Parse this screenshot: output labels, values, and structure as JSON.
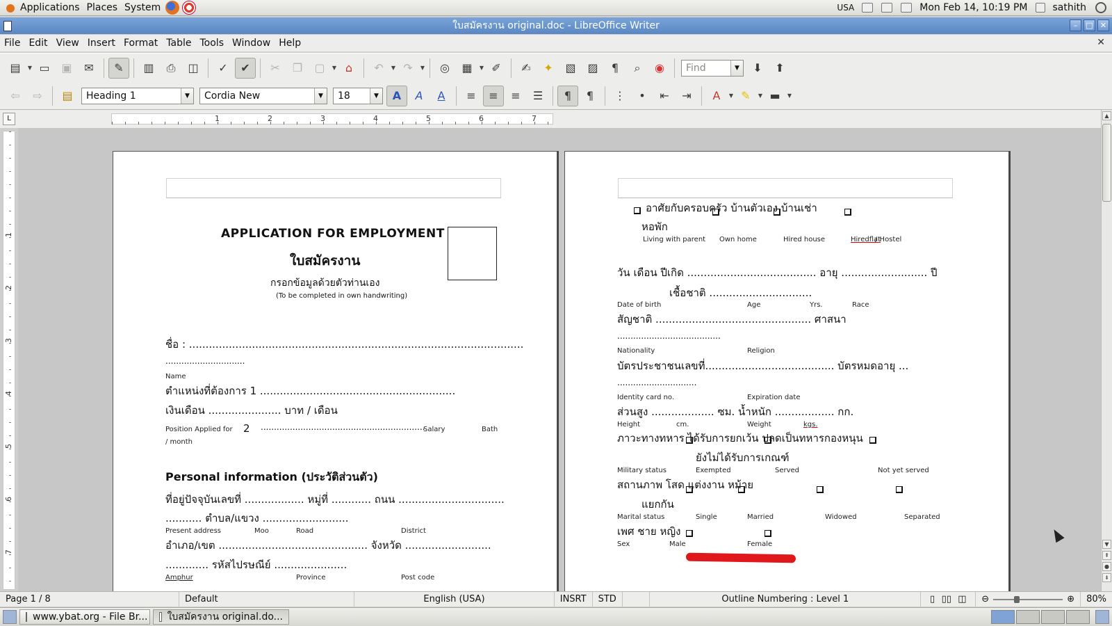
{
  "panel": {
    "applications": "Applications",
    "places": "Places",
    "system": "System",
    "locale": "USA",
    "clock": "Mon Feb 14, 10:19 PM",
    "user": "sathith"
  },
  "window": {
    "title": "ใบสมัครงาน original.doc - LibreOffice Writer",
    "minimize_label": "–",
    "maximize_label": "□",
    "close_label": "✕"
  },
  "menubar": {
    "items": [
      "File",
      "Edit",
      "View",
      "Insert",
      "Format",
      "Table",
      "Tools",
      "Window",
      "Help"
    ],
    "doc_close": "✕"
  },
  "toolbar": {
    "find_placeholder": "Find"
  },
  "formatting": {
    "paragraph_style": "Heading 1",
    "font_name": "Cordia New",
    "font_size": "18"
  },
  "ruler": {
    "labels": [
      "1",
      "2",
      "3",
      "4",
      "5",
      "6",
      "7"
    ],
    "vlabels": [
      "1",
      "2",
      "3",
      "4",
      "5",
      "6",
      "7"
    ]
  },
  "page1": {
    "title_en": "APPLICATION FOR EMPLOYMENT",
    "title_th": "ใบสมัครงาน",
    "instruction_th": "กรอกข้อมูลด้วยตัวท่านเอง",
    "instruction_en": "(To be completed in own handwriting)",
    "name_th": "ชื่อ   :  .....................................................................................................",
    "name_cont": "..............................",
    "name_en": "Name",
    "position_th": "ตำแหน่งที่ต้องการ               1         ...........................................................",
    "salary_th": "เงินเดือน   ......................   บาท / เดือน",
    "position_en": "Position Applied for",
    "position_num": "2",
    "position_dots": "..............................................................",
    "salary_en": "Salary",
    "bath_en": "Bath",
    "month_en": "/ month",
    "personal_heading": "Personal information (ประวัติส่วนตัว)",
    "address_th": "ที่อยู่ปัจจุบันเลขที่  ..................  หมู่ที่  ............   ถนน   ................................",
    "address_cont": "...........      ตำบล/แขวง    ..........................",
    "present_en": "Present address",
    "moo_en": "Moo",
    "road_en": "Road",
    "district_en": "District",
    "amphur_th": "อำเภอ/เขต   .............................................        จังหวัด    ..........................",
    "postal_th": ".............      รหัสไปรษณีย์    ......................",
    "amphur_en": "Amphur",
    "province_en": "Province",
    "postcode_en": "Post code"
  },
  "page2": {
    "living_th": "อาศัยกับครอบครัว     บ้านตัวเอง           บ้านเช่า",
    "dorm_th": "หอพัก",
    "living_en": "Living with parent",
    "own_home_en": "Own home",
    "hired_house_en": "Hired house",
    "hiredflat_en": "Hiredflat",
    "hostel_en": "/ Hostel",
    "dob_th": "วัน เดือน ปีเกิด  .......................................   อายุ  ..........................   ปี",
    "race_th": "เชื้อชาติ   ...............................",
    "dob_en": "Date of birth",
    "age_en": "Age",
    "yrs_en": "Yrs.",
    "race_en": "Race",
    "nationality_th": "สัญชาติ   ...............................................           ศาสนา",
    "nationality_cont": ".......................................",
    "nationality_en": "Nationality",
    "religion_en": "Religion",
    "idcard_th": "บัตรประชาชนเลขที่.......................................          บัตรหมดอายุ   ...",
    "idcard_cont": "..............................",
    "idcard_en": "Identity card no.",
    "expiration_en": "Expiration date",
    "height_th": "ส่วนสูง  ...................   ซม.                  น้ำหนัก  ..................  กก.",
    "height_en": "Height",
    "cm_en": "cm.",
    "weight_en": "Weight",
    "kgs_en": "kgs.",
    "military_th": "ภาวะทางทหาร        ได้รับการยกเว้น        ปลดเป็นทหารกองหนุน",
    "not_drafted_th": "ยังไม่ได้รับการเกณฑ์",
    "military_en": "Military status",
    "exempted_en": "Exempted",
    "served_en": "Served",
    "not_served_en": "Not yet served",
    "marital_th": "สถานภาพ        โสด        แต่งงาน                   หม้าย",
    "separated_th": "แยกกัน",
    "marital_en": "Marital status",
    "single_en": "Single",
    "married_en": "Married",
    "widowed_en": "Widowed",
    "separated_en": "Separated",
    "sex_th": "เพศ               ชาย                   หญิง",
    "sex_en": "Sex",
    "male_en": "Male",
    "female_en": "Female"
  },
  "status": {
    "page": "Page 1 / 8",
    "style": "Default",
    "language": "English (USA)",
    "insert_mode": "INSRT",
    "selection_mode": "STD",
    "outline": "Outline Numbering : Level 1",
    "zoom": "80%"
  },
  "taskbar": {
    "items": [
      "www.ybat.org - File Br...",
      "ใบสมัครงาน original.do..."
    ]
  }
}
